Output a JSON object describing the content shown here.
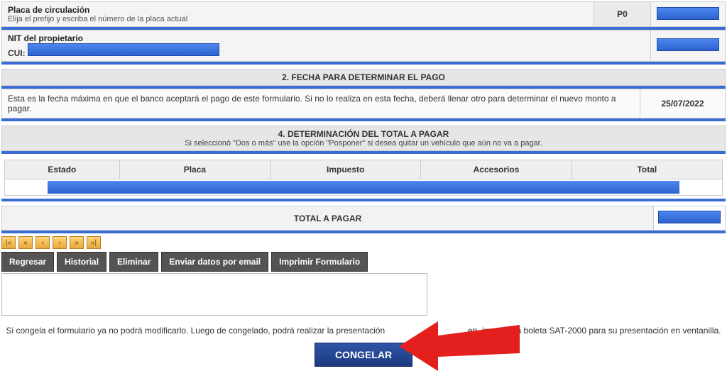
{
  "placa": {
    "label": "Placa de circulación",
    "sub": "Elija el prefijo y escriba el número de la placa actual",
    "prefix": "P0"
  },
  "nit": {
    "label": "NIT del propietario",
    "cui_label": "CUI:"
  },
  "section2": {
    "title": "2. FECHA PARA DETERMINAR EL PAGO",
    "info": "Esta es la fecha máxima en que el banco aceptará el pago de este formulario. Si no lo realiza en esta fecha, deberá llenar otro para determinar el nuevo monto a pagar.",
    "date": "25/07/2022"
  },
  "section4": {
    "title": "4. DETERMINACIÓN DEL TOTAL A PAGAR",
    "sub": "Si seleccionó \"Dos o más\" use la opción \"Posponer\" si desea quitar un vehículo que aún no va a pagar.",
    "headers": [
      "Estado",
      "Placa",
      "Impuesto",
      "Accesorios",
      "Total"
    ]
  },
  "total_row": {
    "label": "TOTAL A PAGAR"
  },
  "nav": [
    "|«",
    "«",
    "‹",
    "›",
    "»",
    "»|"
  ],
  "actions": {
    "regresar": "Regresar",
    "historial": "Historial",
    "eliminar": "Eliminar",
    "enviar": "Enviar datos por email",
    "imprimir": "Imprimir Formulario"
  },
  "congelar": {
    "text_a": "Si congela el formulario ya no podrá modificarlo. Luego de congelado, podrá realizar la presentación",
    "text_b": "en, imprimir la boleta SAT-2000 para su presentación en ventanilla.",
    "button": "CONGELAR"
  }
}
